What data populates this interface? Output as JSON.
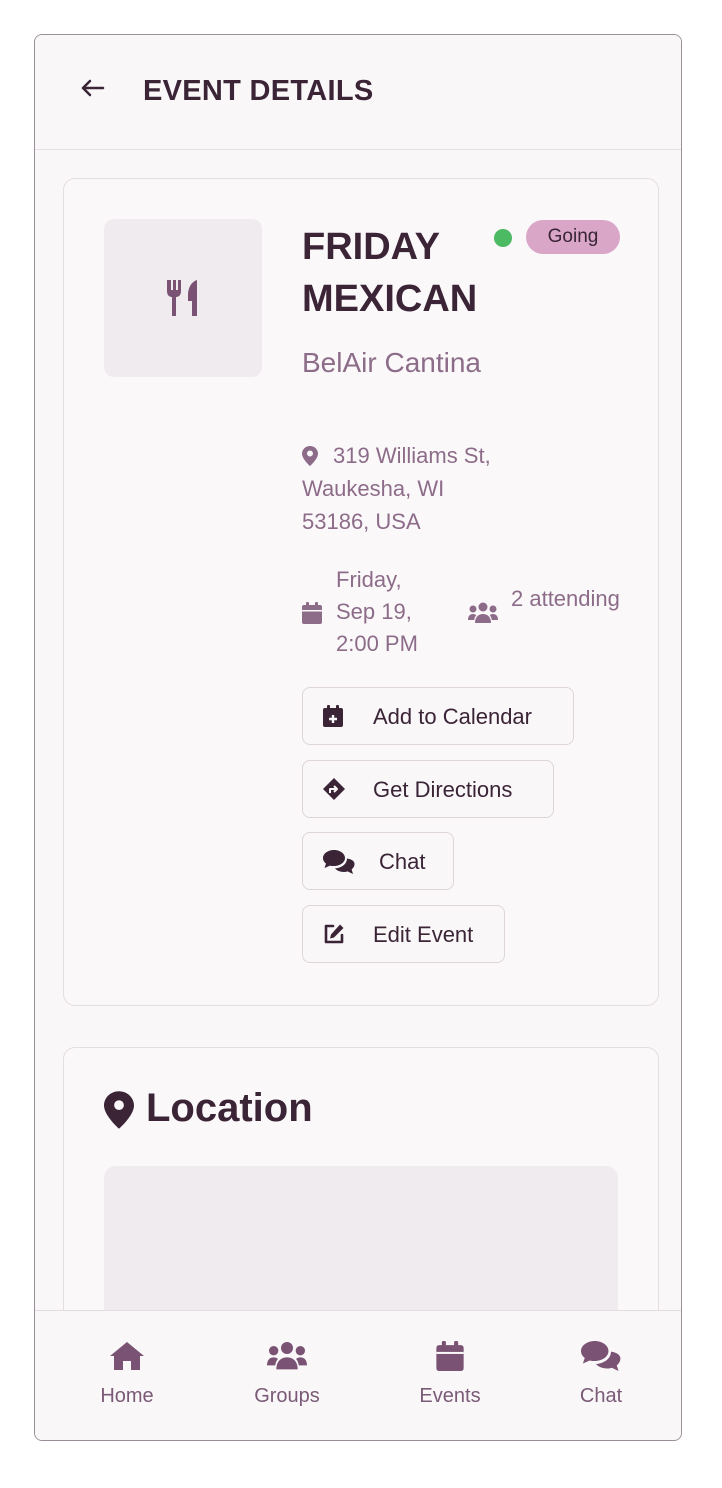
{
  "header": {
    "title": "EVENT DETAILS",
    "back_icon": "arrow-left-icon"
  },
  "event": {
    "thumbnail_icon": "utensils-icon",
    "title": "FRIDAY MEXICAN",
    "status_badge": "Going",
    "status_color": "#4cb963",
    "venue": "BelAir Cantina",
    "address": "319 Williams St, Waukesha, WI 53186, USA",
    "datetime": "Friday, Sep 19, 2:00 PM",
    "attending": "2 attending",
    "actions": {
      "add_calendar": "Add to Calendar",
      "directions": "Get Directions",
      "chat": "Chat",
      "edit": "Edit Event"
    }
  },
  "location": {
    "title": "Location"
  },
  "nav": {
    "home": "Home",
    "groups": "Groups",
    "events": "Events",
    "chat": "Chat"
  },
  "colors": {
    "primary": "#3a2436",
    "muted": "#8c6c88",
    "badge": "#d9a6c8",
    "accent_nav": "#7a5a76"
  }
}
